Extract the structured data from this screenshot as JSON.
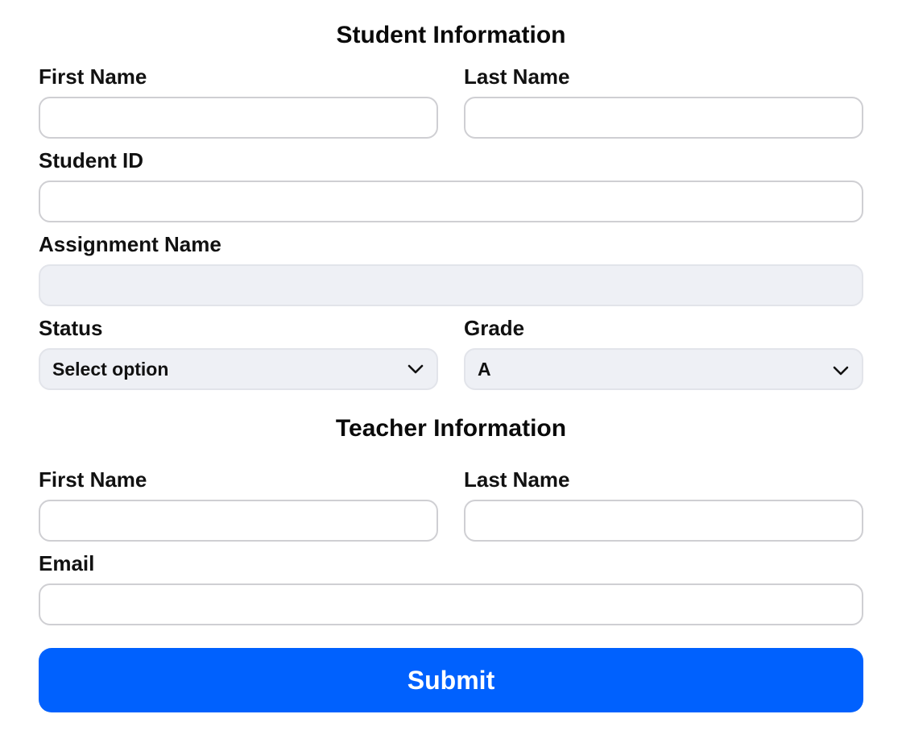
{
  "student": {
    "title": "Student Information",
    "first_name": {
      "label": "First Name",
      "value": "",
      "placeholder": ""
    },
    "last_name": {
      "label": "Last Name",
      "value": "",
      "placeholder": ""
    },
    "student_id": {
      "label": "Student ID",
      "value": "",
      "placeholder": ""
    },
    "assignment_name": {
      "label": "Assignment Name",
      "value": "",
      "placeholder": "",
      "disabled": true
    },
    "status": {
      "label": "Status",
      "selected": "Select option"
    },
    "grade": {
      "label": "Grade",
      "selected": "A"
    }
  },
  "teacher": {
    "title": "Teacher Information",
    "first_name": {
      "label": "First Name",
      "value": "",
      "placeholder": ""
    },
    "last_name": {
      "label": "Last Name",
      "value": "",
      "placeholder": ""
    },
    "email": {
      "label": "Email",
      "value": "",
      "placeholder": ""
    }
  },
  "submit_label": "Submit",
  "colors": {
    "accent": "#0061fe",
    "field_border": "#cfcfd3",
    "disabled_bg": "#eef0f5"
  },
  "icons": {
    "select_arrow": "chevron-down-icon"
  }
}
